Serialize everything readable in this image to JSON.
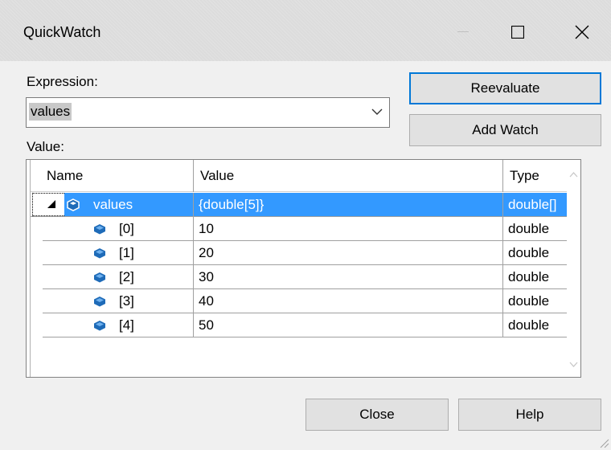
{
  "window": {
    "title": "QuickWatch",
    "minimize_icon": "minimize-icon",
    "maximize_icon": "maximize-icon",
    "close_icon": "close-icon"
  },
  "expression": {
    "label": "Expression:",
    "value": "values"
  },
  "value_label": "Value:",
  "buttons": {
    "reevaluate": "Reevaluate",
    "add_watch": "Add Watch",
    "close": "Close",
    "help": "Help"
  },
  "grid": {
    "columns": [
      "Name",
      "Value",
      "Type"
    ],
    "rows": [
      {
        "name": "values",
        "value": "{double[5]}",
        "type": "double[]",
        "selected": true,
        "expanded": true
      },
      {
        "name": "[0]",
        "value": "10",
        "type": "double"
      },
      {
        "name": "[1]",
        "value": "20",
        "type": "double"
      },
      {
        "name": "[2]",
        "value": "30",
        "type": "double"
      },
      {
        "name": "[3]",
        "value": "40",
        "type": "double"
      },
      {
        "name": "[4]",
        "value": "50",
        "type": "double"
      }
    ]
  },
  "colors": {
    "selection": "#3399ff",
    "default_button_border": "#0078d7",
    "field_icon": "#1e6bb8"
  }
}
